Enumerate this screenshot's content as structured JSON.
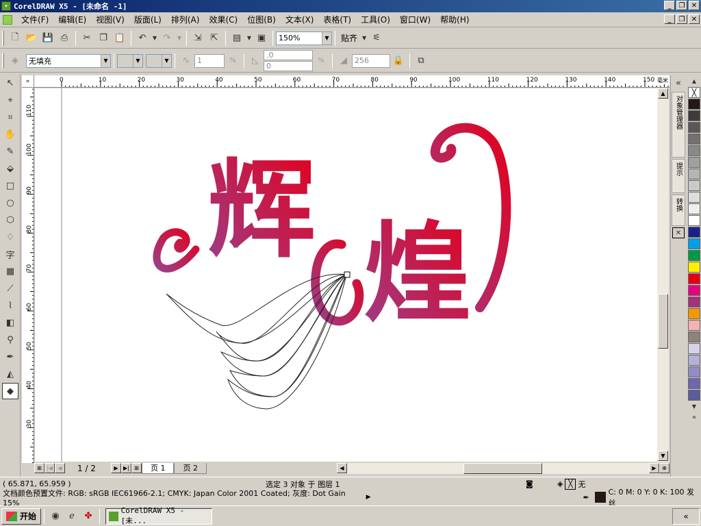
{
  "window": {
    "title": "CorelDRAW X5 - [未命名 -1]"
  },
  "menu": [
    "文件(F)",
    "编辑(E)",
    "视图(V)",
    "版面(L)",
    "排列(A)",
    "效果(C)",
    "位图(B)",
    "文本(X)",
    "表格(T)",
    "工具(O)",
    "窗口(W)",
    "帮助(H)"
  ],
  "toolbar": {
    "zoom_value": "150%",
    "snap_label": "贴齐"
  },
  "property_bar": {
    "fill_type": "无填充",
    "steps_value": "1",
    "angle1_value": ".0",
    "angle2_value": "0",
    "color_count_value": "256"
  },
  "ruler": {
    "horizontal_ticks": [
      "0",
      "10",
      "20",
      "30",
      "40",
      "50",
      "60",
      "70",
      "80",
      "90",
      "100",
      "110",
      "120",
      "130",
      "140",
      "150"
    ],
    "vertical_ticks": [
      "110",
      "100",
      "90",
      "80",
      "70",
      "60",
      "50",
      "40",
      "30"
    ],
    "unit": "毫米"
  },
  "artwork": {
    "char1": "辉",
    "char2": "煌",
    "gradient_start": "#9b3f8a",
    "gradient_end": "#e3001b"
  },
  "pages": {
    "indicator": "1 / 2",
    "tabs": [
      "页 1",
      "页 2"
    ],
    "active": 0
  },
  "dockers": [
    "对象管理器",
    "提示",
    "转换"
  ],
  "palette": [
    "#231815",
    "#3e3a39",
    "#595757",
    "#727171",
    "#898989",
    "#9fa0a0",
    "#b5b5b6",
    "#c9caca",
    "#dcdddd",
    "#efefef",
    "#ffffff",
    "#1d2088",
    "#00a0e9",
    "#009944",
    "#fff100",
    "#e60012",
    "#e4007f",
    "#a4327c",
    "#f39800",
    "#f5b2b2",
    "#8f8278",
    "#d5d2e8",
    "#b4b0d6",
    "#938cc6",
    "#7066b0",
    "#5b5c9f"
  ],
  "status": {
    "coords": "( 65.871, 65.959 )",
    "selection": "选定 3 对象 于 图层 1",
    "fill_none": "无",
    "color_profile": "文档颜色预置文件: RGB: sRGB IEC61966-2.1; CMYK: Japan Color 2001 Coated; 灰度: Dot Gain 15%",
    "outline": "C: 0 M: 0 Y: 0 K: 100  发丝"
  },
  "taskbar": {
    "start": "开始",
    "task": "CorelDRAW X5 - [未..."
  }
}
